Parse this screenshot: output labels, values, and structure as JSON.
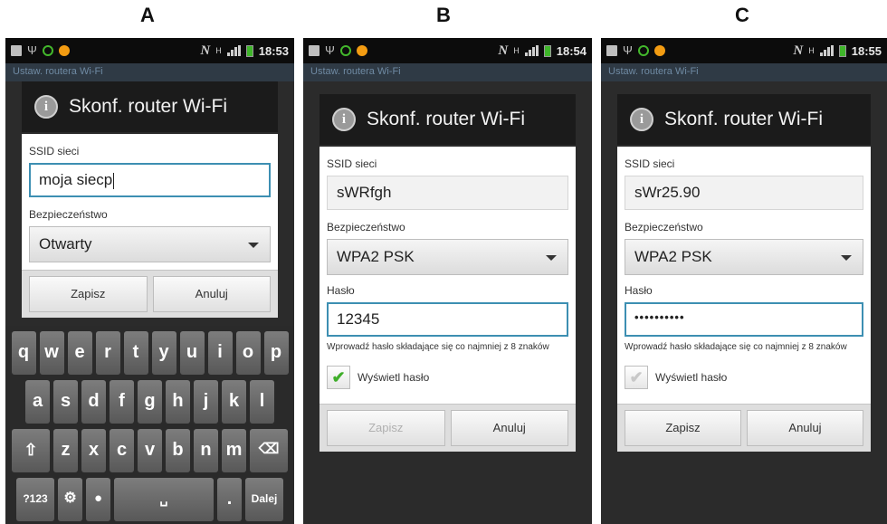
{
  "panels": [
    {
      "label": "A",
      "status": {
        "time": "18:53"
      },
      "app_title": "Ustaw. routera Wi-Fi",
      "dialog": {
        "title": "Skonf. router Wi-Fi",
        "ssid_label": "SSID sieci",
        "ssid_value": "moja siecp",
        "security_label": "Bezpieczeństwo",
        "security_value": "Otwarty",
        "save_label": "Zapisz",
        "cancel_label": "Anuluj"
      },
      "keyboard": {
        "row1": [
          "q",
          "w",
          "e",
          "r",
          "t",
          "y",
          "u",
          "i",
          "o",
          "p"
        ],
        "row2": [
          "a",
          "s",
          "d",
          "f",
          "g",
          "h",
          "j",
          "k",
          "l"
        ],
        "row3": [
          "z",
          "x",
          "c",
          "v",
          "b",
          "n",
          "m"
        ],
        "symbols": "?123",
        "done": "Dalej"
      }
    },
    {
      "label": "B",
      "status": {
        "time": "18:54"
      },
      "app_title": "Ustaw. routera Wi-Fi",
      "dialog": {
        "title": "Skonf. router Wi-Fi",
        "ssid_label": "SSID sieci",
        "ssid_value": "sWRfgh",
        "security_label": "Bezpieczeństwo",
        "security_value": "WPA2 PSK",
        "password_label": "Hasło",
        "password_value": "12345",
        "hint": "Wprowadź hasło składające się co najmniej z 8 znaków",
        "show_password_label": "Wyświetl hasło",
        "show_password_checked": true,
        "save_label": "Zapisz",
        "save_enabled": false,
        "cancel_label": "Anuluj"
      }
    },
    {
      "label": "C",
      "status": {
        "time": "18:55"
      },
      "app_title": "Ustaw. routera Wi-Fi",
      "dialog": {
        "title": "Skonf. router Wi-Fi",
        "ssid_label": "SSID sieci",
        "ssid_value": "sWr25.90",
        "security_label": "Bezpieczeństwo",
        "security_value": "WPA2 PSK",
        "password_label": "Hasło",
        "password_value": "••••••••••",
        "hint": "Wprowadź hasło składające się co najmniej z 8 znaków",
        "show_password_label": "Wyświetl hasło",
        "show_password_checked": false,
        "save_label": "Zapisz",
        "save_enabled": true,
        "cancel_label": "Anuluj"
      }
    }
  ],
  "colors": {
    "focus_border": "#3d8fb2",
    "check_green": "#3fae2a",
    "battery_green": "#3fb62a"
  }
}
